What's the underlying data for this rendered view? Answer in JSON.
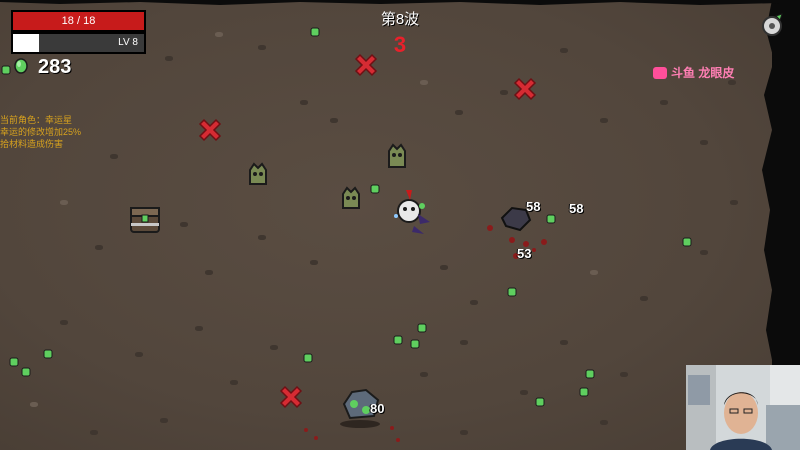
{
  "hud": {
    "hp_text": "18 / 18",
    "hp_fraction": 1.0,
    "level_text": "LV 8",
    "xp_fraction": 0.2,
    "materials": "283"
  },
  "wave": {
    "title": "第8波",
    "timer": "3"
  },
  "character_info": {
    "line1": "当前角色：幸运星",
    "line2": "幸运的修改增加25%",
    "line3": "拾材料造成伤害"
  },
  "watermark": {
    "text": "斗鱼 龙眼皮"
  },
  "damage_numbers": [
    "58",
    "58",
    "53",
    "80"
  ],
  "icons": {
    "material": "material-gem-icon",
    "settings": "settings-gear-icon",
    "spawn_marker": "spawn-x-marker-icon",
    "chest": "loot-chest-icon"
  },
  "colors": {
    "hp": "#c71b1b",
    "xp": "#ffffff",
    "timer": "#e8212b",
    "character_info": "#d7a21e",
    "material": "#5fcf5f",
    "spawn_marker": "#d62b33"
  }
}
